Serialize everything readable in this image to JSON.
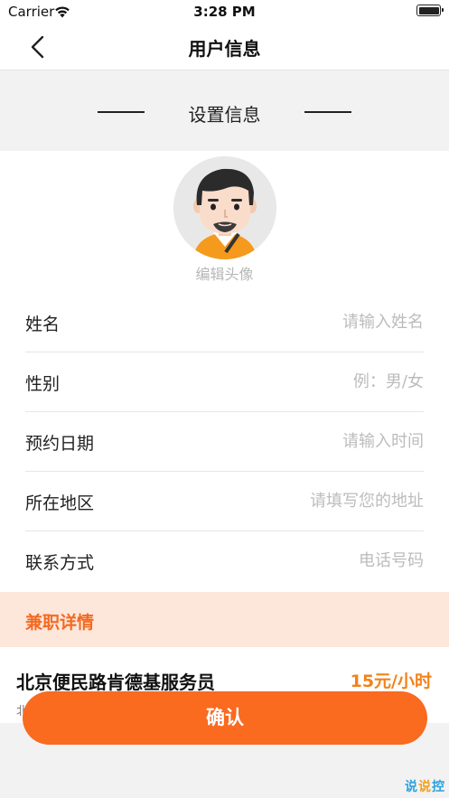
{
  "status_bar": {
    "carrier": "Carrier",
    "time": "3:28 PM"
  },
  "nav": {
    "title": "用户信息"
  },
  "section": {
    "title": "设置信息"
  },
  "avatar": {
    "label": "编辑头像"
  },
  "form": {
    "fields": [
      {
        "label": "姓名",
        "placeholder": "请输入姓名",
        "value": ""
      },
      {
        "label": "性别",
        "placeholder": "例：男/女",
        "value": ""
      },
      {
        "label": "预约日期",
        "placeholder": "请输入时间",
        "value": ""
      },
      {
        "label": "所在地区",
        "placeholder": "请填写您的地址",
        "value": ""
      },
      {
        "label": "联系方式",
        "placeholder": "电话号码",
        "value": ""
      }
    ]
  },
  "detail": {
    "title": "兼职详情",
    "job_title": "北京便民路肯德基服务员",
    "job_price": "15元/小时",
    "job_sub": "北"
  },
  "confirm_button": {
    "label": "确认"
  },
  "watermark": {
    "chars": [
      "说",
      "说",
      "控"
    ]
  },
  "colors": {
    "accent": "#fa6a1f",
    "price": "#f2821a",
    "detail_bg": "#fde6da",
    "page_bg": "#f2f2f2"
  }
}
